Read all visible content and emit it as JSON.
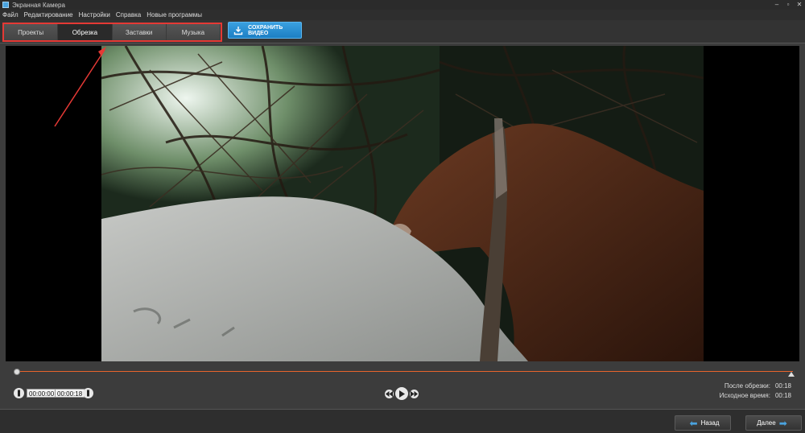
{
  "window": {
    "title": "Экранная Камера"
  },
  "menu": [
    "Файл",
    "Редактирование",
    "Настройки",
    "Справка",
    "Новые программы"
  ],
  "tabs": [
    {
      "label": "Проекты",
      "active": false
    },
    {
      "label": "Обрезка",
      "active": true
    },
    {
      "label": "Заставки",
      "active": false
    },
    {
      "label": "Музыка",
      "active": false
    }
  ],
  "toolbar": {
    "save_label": "СОХРАНИТЬ ВИДЕО"
  },
  "trim": {
    "start": "00:00:00",
    "end": "00:00:18"
  },
  "info": {
    "after_label": "После обрезки:",
    "after_value": "00:18",
    "source_label": "Исходное время:",
    "source_value": "00:18"
  },
  "nav": {
    "back_label": "Назад",
    "next_label": "Далее"
  },
  "colors": {
    "accent": "#2f95d8",
    "timeline": "#e8642c",
    "highlight": "#e53935"
  }
}
